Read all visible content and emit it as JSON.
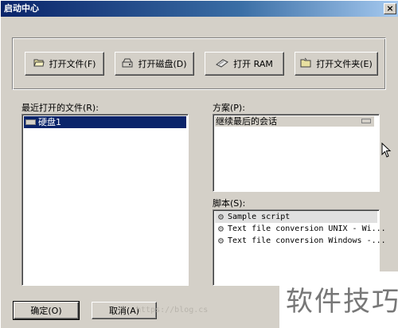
{
  "window": {
    "title": "启动中心",
    "close_glyph": "×"
  },
  "toolbar": {
    "open_file": "打开文件(F)",
    "open_disk": "打开磁盘(D)",
    "open_ram": "打开 RAM",
    "open_folder": "打开文件夹(E)"
  },
  "recent": {
    "label": "最近打开的文件(R):",
    "items": [
      "硬盘1"
    ]
  },
  "scheme": {
    "label": "方案(P):",
    "items": [
      "继续最后的会话"
    ]
  },
  "scripts": {
    "label": "脚本(S):",
    "items": [
      "Sample script",
      "Text file conversion UNIX - Wi...",
      "Text file conversion Windows -..."
    ]
  },
  "buttons": {
    "ok": "确定(O)",
    "cancel": "取消(A)"
  },
  "watermark": {
    "text": "软件技巧",
    "url": "https://blog.cs"
  },
  "colors": {
    "face": "#d4d0c8",
    "title_start": "#0a246a",
    "title_end": "#a6caf0",
    "selection": "#0a246a"
  },
  "icons": {
    "open_file": "folder-open-icon",
    "open_disk": "disk-icon",
    "open_ram": "ram-chip-icon",
    "open_folder": "folder-icon",
    "recent_item": "hard-drive-icon",
    "script_item": "gear-icon"
  }
}
